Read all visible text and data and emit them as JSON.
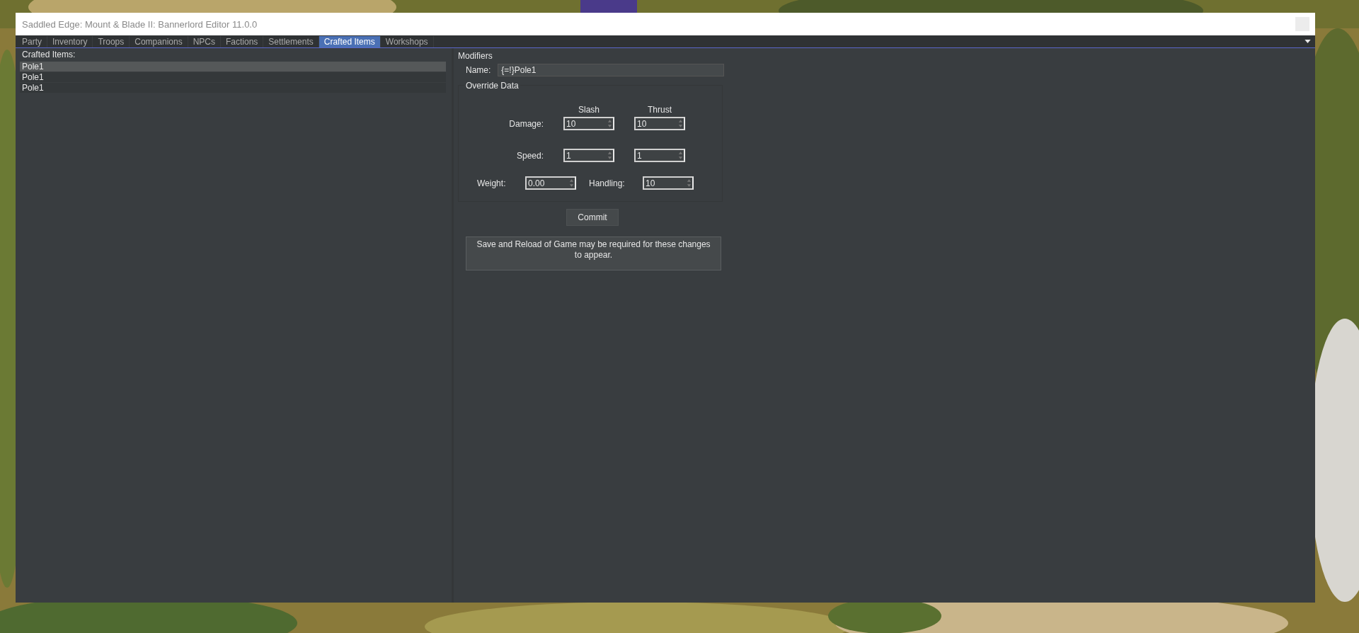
{
  "window": {
    "title": "Saddled Edge:  Mount & Blade II: Bannerlord Editor 11.0.0"
  },
  "tabs": [
    {
      "label": "Party",
      "selected": false
    },
    {
      "label": "Inventory",
      "selected": false
    },
    {
      "label": "Troops",
      "selected": false
    },
    {
      "label": "Companions",
      "selected": false
    },
    {
      "label": "NPCs",
      "selected": false
    },
    {
      "label": "Factions",
      "selected": false
    },
    {
      "label": "Settlements",
      "selected": false
    },
    {
      "label": "Crafted Items",
      "selected": true
    },
    {
      "label": "Workshops",
      "selected": false
    }
  ],
  "crafted_items": {
    "label": "Crafted Items:",
    "items": [
      {
        "name": "Pole1",
        "selected": true
      },
      {
        "name": "Pole1",
        "selected": false
      },
      {
        "name": "Pole1",
        "selected": false
      }
    ]
  },
  "modifiers": {
    "title": "Modifiers",
    "name_label": "Name:",
    "name_value": "{=!}Pole1",
    "override": {
      "title": "Override Data",
      "columns": [
        "Slash",
        "Thrust"
      ],
      "rows": [
        {
          "label": "Damage:",
          "values": [
            "10",
            "10"
          ]
        },
        {
          "label": "Speed:",
          "values": [
            "1",
            "1"
          ]
        }
      ],
      "weight": {
        "label": "Weight:",
        "value": "0.00"
      },
      "handling": {
        "label": "Handling:",
        "value": "10"
      }
    },
    "commit": "Commit",
    "notice": "Save and Reload of Game may be required for these changes to appear."
  }
}
